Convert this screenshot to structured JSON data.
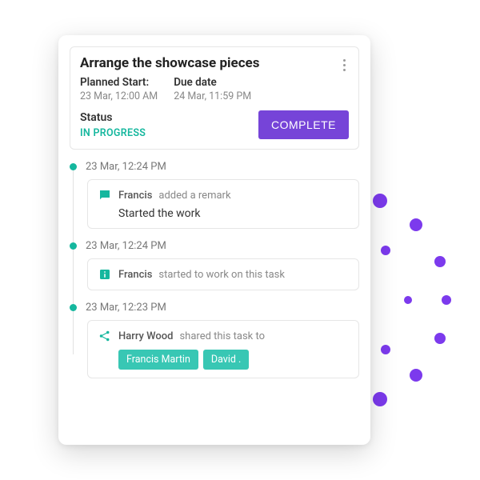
{
  "header": {
    "title": "Arrange the showcase pieces",
    "planned_start_label": "Planned Start:",
    "planned_start_value": "23 Mar, 12:00 AM",
    "due_label": "Due date",
    "due_value": "24 Mar, 11:59 PM",
    "status_label": "Status",
    "status_value": "IN PROGRESS",
    "complete_button": "COMPLETE"
  },
  "timeline": [
    {
      "time": "23 Mar, 12:24 PM",
      "icon": "comment",
      "actor": "Francis",
      "action": "added a remark",
      "remark": "Started the work"
    },
    {
      "time": "23 Mar, 12:24 PM",
      "icon": "info",
      "actor": "Francis",
      "action": "started to work on this task"
    },
    {
      "time": "23 Mar, 12:23 PM",
      "icon": "share",
      "actor": "Harry Wood",
      "action": "shared this task to",
      "tags": [
        "Francis Martin",
        "David ."
      ]
    }
  ]
}
